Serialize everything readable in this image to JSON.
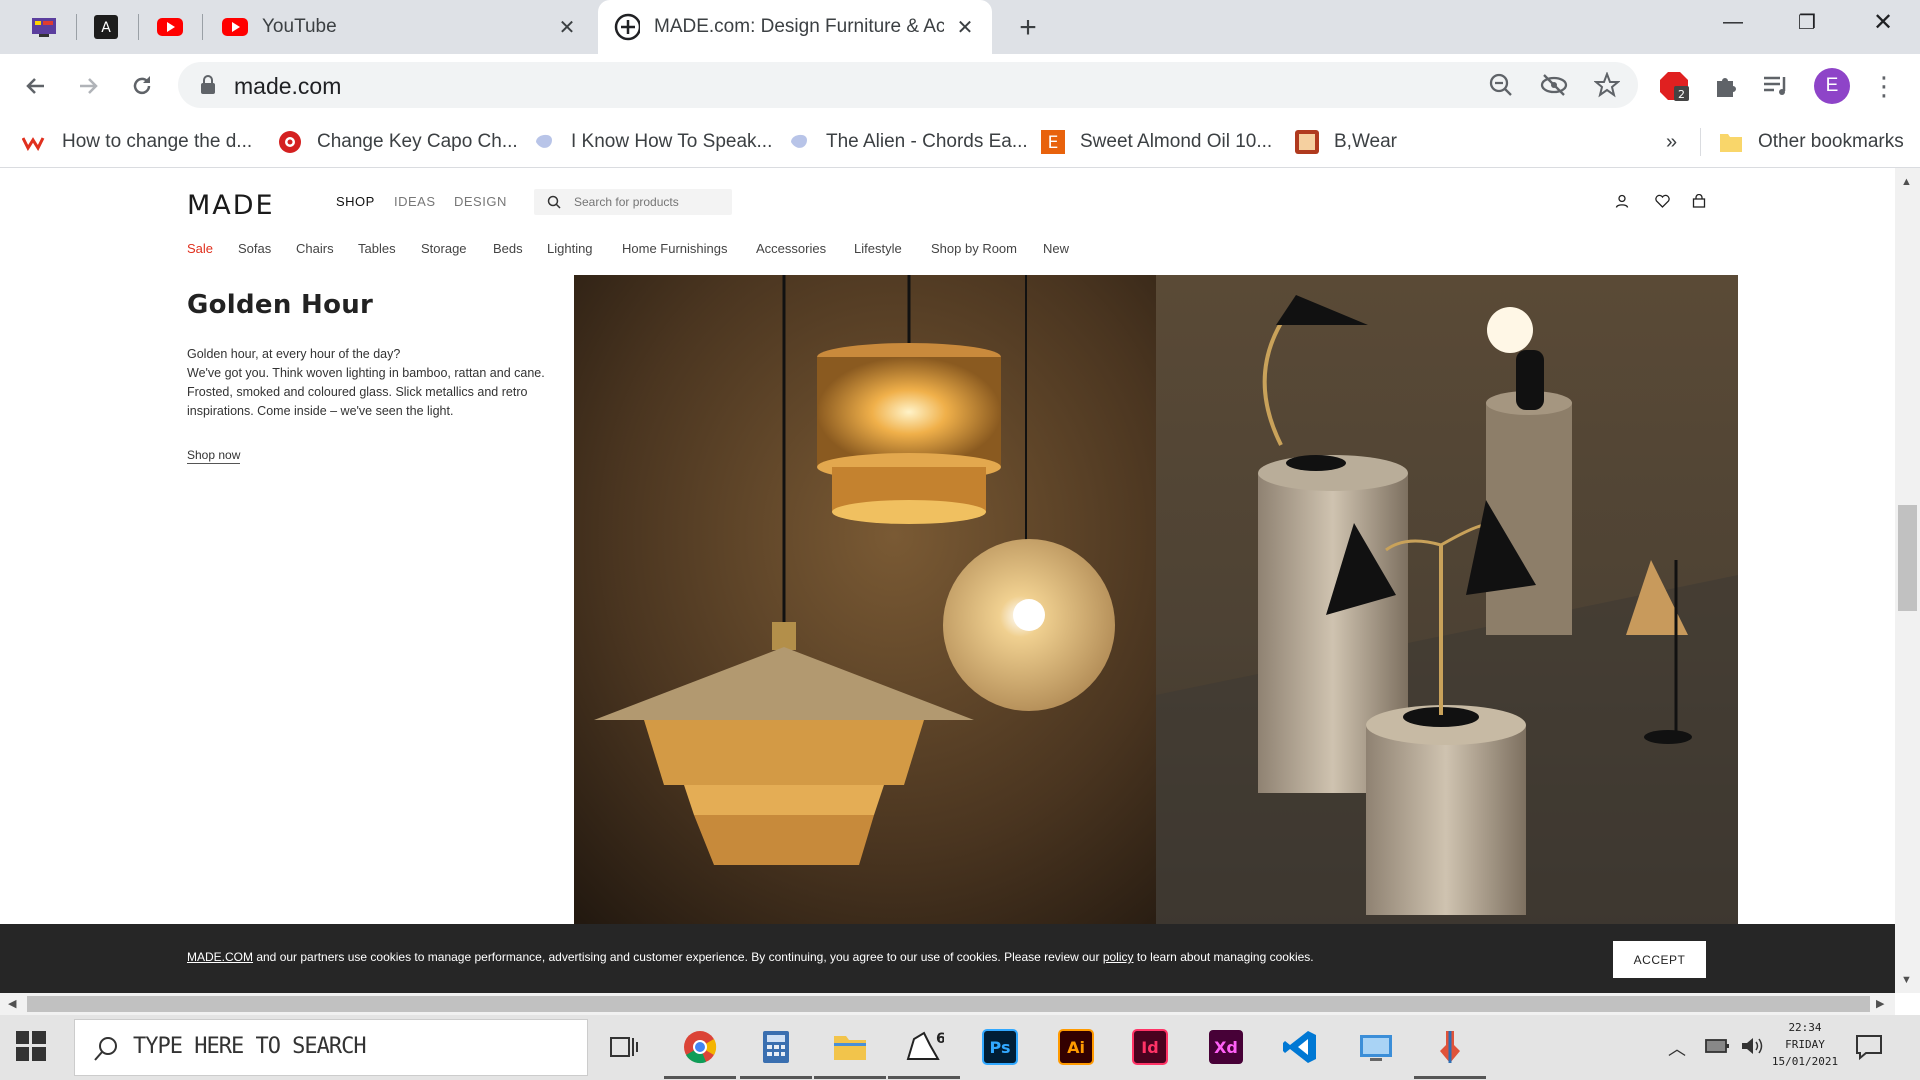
{
  "browser": {
    "tabs": [
      {
        "title": "YouTube",
        "active": false
      },
      {
        "title": "MADE.com: Design Furniture & Acce",
        "active": true
      }
    ],
    "url": "made.com",
    "profile_initial": "E",
    "extension_badge": "2",
    "bookmarks": [
      "How to change the d...",
      "Change Key Capo Ch...",
      "I Know How To Speak...",
      "The Alien - Chords Ea...",
      "Sweet Almond Oil 10...",
      "B,Wear"
    ],
    "bookmarks_overflow": "»",
    "other_bookmarks": "Other bookmarks"
  },
  "site": {
    "logo": "MADE",
    "top_nav": [
      "SHOP",
      "IDEAS",
      "DESIGN"
    ],
    "search_placeholder": "Search for products",
    "categories": [
      "Sale",
      "Sofas",
      "Chairs",
      "Tables",
      "Storage",
      "Beds",
      "Lighting",
      "Home Furnishings",
      "Accessories",
      "Lifestyle",
      "Shop by Room",
      "New"
    ],
    "sale_color": "#e0301e",
    "hero": {
      "title": "Golden Hour",
      "line1": "Golden hour, at every hour of the day?",
      "line2": "We've got you. Think woven lighting in bamboo, rattan and cane. Frosted, smoked and coloured glass. Slick metallics and retro inspirations. Come inside – we've seen the light.",
      "cta": "Shop now"
    },
    "cookie": {
      "brand": "MADE.COM",
      "text_a": " and our partners use cookies to manage performance, advertising and customer experience. By continuing, you agree to our use of cookies. Please review our ",
      "policy": "policy",
      "text_b": " to learn about managing cookies.",
      "accept": "ACCEPT"
    }
  },
  "taskbar": {
    "search_placeholder": "TYPE HERE TO SEARCH",
    "time": "22:34",
    "day": "FRIDAY",
    "date": "15/01/2021",
    "apps": [
      "Chrome",
      "Calculator",
      "File Explorer",
      "Rhino 6",
      "Ps",
      "Ai",
      "Id",
      "Xd",
      "VS Code",
      "Control Panel",
      "App"
    ]
  }
}
